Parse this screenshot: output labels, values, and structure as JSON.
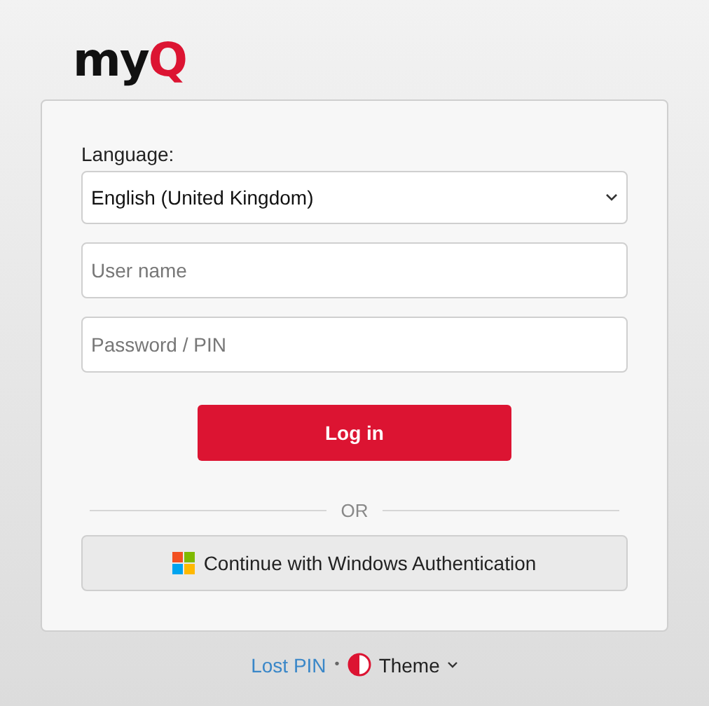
{
  "logo": {
    "text": "my",
    "accent": "Q"
  },
  "form": {
    "language_label": "Language:",
    "language_value": "English (United Kingdom)",
    "username": {
      "placeholder": "User name"
    },
    "password": {
      "placeholder": "Password / PIN"
    },
    "login_button": "Log in",
    "separator": "OR",
    "windows_button": "Continue with Windows Authentication"
  },
  "footer": {
    "lost_pin": "Lost PIN",
    "bullet": "•",
    "theme": "Theme"
  }
}
